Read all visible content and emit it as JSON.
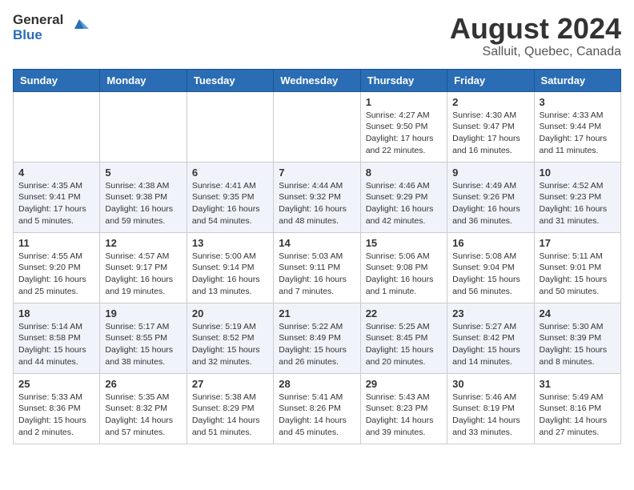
{
  "header": {
    "logo": {
      "general": "General",
      "blue": "Blue"
    },
    "title": "August 2024",
    "location": "Salluit, Quebec, Canada"
  },
  "calendar": {
    "days_of_week": [
      "Sunday",
      "Monday",
      "Tuesday",
      "Wednesday",
      "Thursday",
      "Friday",
      "Saturday"
    ],
    "weeks": [
      [
        {
          "day": "",
          "info": ""
        },
        {
          "day": "",
          "info": ""
        },
        {
          "day": "",
          "info": ""
        },
        {
          "day": "",
          "info": ""
        },
        {
          "day": "1",
          "info": "Sunrise: 4:27 AM\nSunset: 9:50 PM\nDaylight: 17 hours\nand 22 minutes."
        },
        {
          "day": "2",
          "info": "Sunrise: 4:30 AM\nSunset: 9:47 PM\nDaylight: 17 hours\nand 16 minutes."
        },
        {
          "day": "3",
          "info": "Sunrise: 4:33 AM\nSunset: 9:44 PM\nDaylight: 17 hours\nand 11 minutes."
        }
      ],
      [
        {
          "day": "4",
          "info": "Sunrise: 4:35 AM\nSunset: 9:41 PM\nDaylight: 17 hours\nand 5 minutes."
        },
        {
          "day": "5",
          "info": "Sunrise: 4:38 AM\nSunset: 9:38 PM\nDaylight: 16 hours\nand 59 minutes."
        },
        {
          "day": "6",
          "info": "Sunrise: 4:41 AM\nSunset: 9:35 PM\nDaylight: 16 hours\nand 54 minutes."
        },
        {
          "day": "7",
          "info": "Sunrise: 4:44 AM\nSunset: 9:32 PM\nDaylight: 16 hours\nand 48 minutes."
        },
        {
          "day": "8",
          "info": "Sunrise: 4:46 AM\nSunset: 9:29 PM\nDaylight: 16 hours\nand 42 minutes."
        },
        {
          "day": "9",
          "info": "Sunrise: 4:49 AM\nSunset: 9:26 PM\nDaylight: 16 hours\nand 36 minutes."
        },
        {
          "day": "10",
          "info": "Sunrise: 4:52 AM\nSunset: 9:23 PM\nDaylight: 16 hours\nand 31 minutes."
        }
      ],
      [
        {
          "day": "11",
          "info": "Sunrise: 4:55 AM\nSunset: 9:20 PM\nDaylight: 16 hours\nand 25 minutes."
        },
        {
          "day": "12",
          "info": "Sunrise: 4:57 AM\nSunset: 9:17 PM\nDaylight: 16 hours\nand 19 minutes."
        },
        {
          "day": "13",
          "info": "Sunrise: 5:00 AM\nSunset: 9:14 PM\nDaylight: 16 hours\nand 13 minutes."
        },
        {
          "day": "14",
          "info": "Sunrise: 5:03 AM\nSunset: 9:11 PM\nDaylight: 16 hours\nand 7 minutes."
        },
        {
          "day": "15",
          "info": "Sunrise: 5:06 AM\nSunset: 9:08 PM\nDaylight: 16 hours\nand 1 minute."
        },
        {
          "day": "16",
          "info": "Sunrise: 5:08 AM\nSunset: 9:04 PM\nDaylight: 15 hours\nand 56 minutes."
        },
        {
          "day": "17",
          "info": "Sunrise: 5:11 AM\nSunset: 9:01 PM\nDaylight: 15 hours\nand 50 minutes."
        }
      ],
      [
        {
          "day": "18",
          "info": "Sunrise: 5:14 AM\nSunset: 8:58 PM\nDaylight: 15 hours\nand 44 minutes."
        },
        {
          "day": "19",
          "info": "Sunrise: 5:17 AM\nSunset: 8:55 PM\nDaylight: 15 hours\nand 38 minutes."
        },
        {
          "day": "20",
          "info": "Sunrise: 5:19 AM\nSunset: 8:52 PM\nDaylight: 15 hours\nand 32 minutes."
        },
        {
          "day": "21",
          "info": "Sunrise: 5:22 AM\nSunset: 8:49 PM\nDaylight: 15 hours\nand 26 minutes."
        },
        {
          "day": "22",
          "info": "Sunrise: 5:25 AM\nSunset: 8:45 PM\nDaylight: 15 hours\nand 20 minutes."
        },
        {
          "day": "23",
          "info": "Sunrise: 5:27 AM\nSunset: 8:42 PM\nDaylight: 15 hours\nand 14 minutes."
        },
        {
          "day": "24",
          "info": "Sunrise: 5:30 AM\nSunset: 8:39 PM\nDaylight: 15 hours\nand 8 minutes."
        }
      ],
      [
        {
          "day": "25",
          "info": "Sunrise: 5:33 AM\nSunset: 8:36 PM\nDaylight: 15 hours\nand 2 minutes."
        },
        {
          "day": "26",
          "info": "Sunrise: 5:35 AM\nSunset: 8:32 PM\nDaylight: 14 hours\nand 57 minutes."
        },
        {
          "day": "27",
          "info": "Sunrise: 5:38 AM\nSunset: 8:29 PM\nDaylight: 14 hours\nand 51 minutes."
        },
        {
          "day": "28",
          "info": "Sunrise: 5:41 AM\nSunset: 8:26 PM\nDaylight: 14 hours\nand 45 minutes."
        },
        {
          "day": "29",
          "info": "Sunrise: 5:43 AM\nSunset: 8:23 PM\nDaylight: 14 hours\nand 39 minutes."
        },
        {
          "day": "30",
          "info": "Sunrise: 5:46 AM\nSunset: 8:19 PM\nDaylight: 14 hours\nand 33 minutes."
        },
        {
          "day": "31",
          "info": "Sunrise: 5:49 AM\nSunset: 8:16 PM\nDaylight: 14 hours\nand 27 minutes."
        }
      ]
    ]
  }
}
